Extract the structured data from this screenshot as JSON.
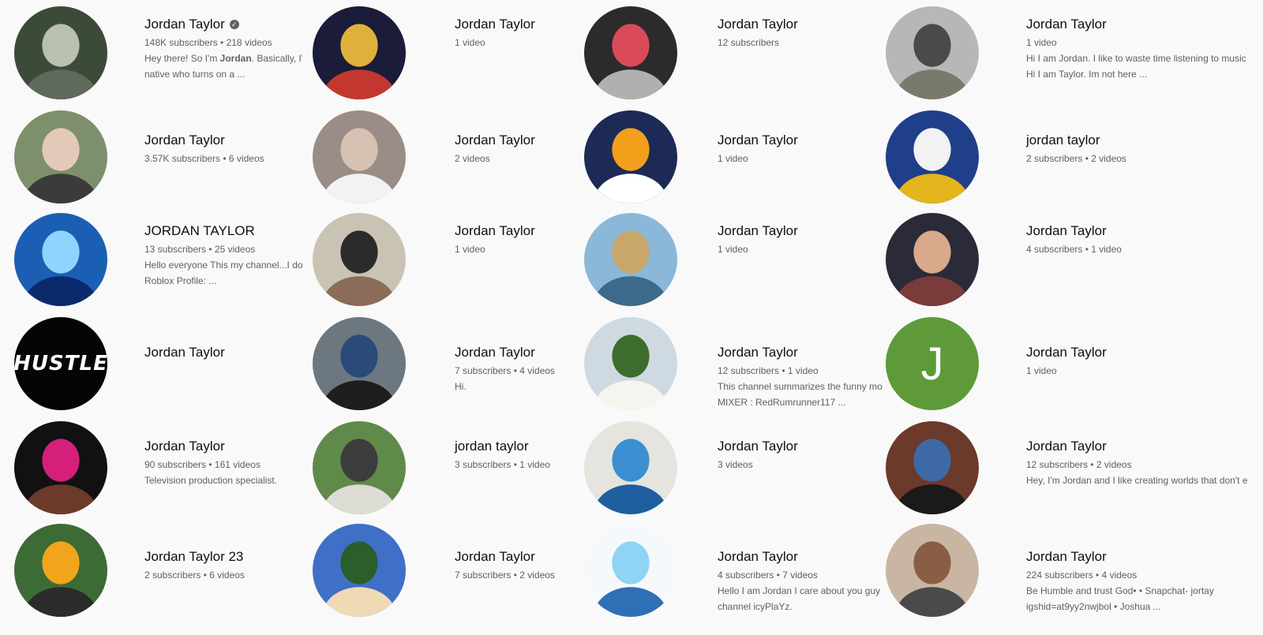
{
  "results": [
    {
      "name": "Jordan Taylor",
      "verified": true,
      "meta": "148K subscribers • 218 videos",
      "desc_lines": [
        "Hey there! So I'm |Jordan|. Basically, I'm",
        "native who turns on a ..."
      ],
      "avatar": {
        "type": "photo",
        "colors": [
          "#3c4a38",
          "#b9c0b0",
          "#5f6a5c"
        ]
      }
    },
    {
      "name": "Jordan Taylor",
      "verified": false,
      "meta": "3.57K subscribers • 6 videos",
      "desc_lines": [],
      "avatar": {
        "type": "photo",
        "colors": [
          "#7e8f6c",
          "#e3c9b8",
          "#3b3b3b"
        ]
      }
    },
    {
      "name": "JORDAN TAYLOR",
      "verified": false,
      "meta": "13 subscribers • 25 videos",
      "desc_lines": [
        "Hello everyone This my channel...I do B",
        "Roblox Profile: ..."
      ],
      "avatar": {
        "type": "photo",
        "colors": [
          "#1b5fb4",
          "#8fd3ff",
          "#0b2a6b"
        ]
      }
    },
    {
      "name": "Jordan Taylor",
      "verified": false,
      "meta": "",
      "desc_lines": [],
      "avatar": {
        "type": "text",
        "text": "HUSTLE",
        "bg": "#050505"
      }
    },
    {
      "name": "Jordan Taylor",
      "verified": false,
      "meta": "90 subscribers • 161 videos",
      "desc_lines": [
        "Television production specialist."
      ],
      "avatar": {
        "type": "photo",
        "colors": [
          "#111111",
          "#d61f7a",
          "#6b3a2a"
        ]
      }
    },
    {
      "name": "Jordan Taylor 23",
      "verified": false,
      "meta": "2 subscribers • 6 videos",
      "desc_lines": [],
      "avatar": {
        "type": "photo",
        "colors": [
          "#3d6b36",
          "#f2a51c",
          "#2b2b2b"
        ]
      }
    },
    {
      "name": "Jordan Taylor",
      "verified": false,
      "meta": "1 video",
      "desc_lines": [],
      "avatar": {
        "type": "photo",
        "colors": [
          "#1b1b3a",
          "#e0b13a",
          "#c4372e"
        ]
      }
    },
    {
      "name": "Jordan Taylor",
      "verified": false,
      "meta": "2 videos",
      "desc_lines": [],
      "avatar": {
        "type": "photo",
        "colors": [
          "#9a8c86",
          "#d7c1b3",
          "#f2f2f2"
        ]
      }
    },
    {
      "name": "Jordan Taylor",
      "verified": false,
      "meta": "1 video",
      "desc_lines": [],
      "avatar": {
        "type": "photo",
        "colors": [
          "#c9c3b4",
          "#2b2b2b",
          "#8a6c58"
        ]
      }
    },
    {
      "name": "Jordan Taylor",
      "verified": false,
      "meta": "7 subscribers • 4 videos",
      "desc_lines": [
        "Hi."
      ],
      "avatar": {
        "type": "photo",
        "colors": [
          "#6d7780",
          "#2a4a7a",
          "#1e1e1e"
        ]
      }
    },
    {
      "name": "jordan taylor",
      "verified": false,
      "meta": "3 subscribers • 1 video",
      "desc_lines": [],
      "avatar": {
        "type": "photo",
        "colors": [
          "#5f8a4a",
          "#3c3c3c",
          "#dcdcd4"
        ]
      }
    },
    {
      "name": "Jordan Taylor",
      "verified": false,
      "meta": "7 subscribers • 2 videos",
      "desc_lines": [],
      "avatar": {
        "type": "photo",
        "colors": [
          "#3f6fc7",
          "#2a5e2a",
          "#f0d9b5"
        ]
      }
    },
    {
      "name": "Jordan Taylor",
      "verified": false,
      "meta": "12 subscribers",
      "desc_lines": [],
      "avatar": {
        "type": "photo",
        "colors": [
          "#2b2b2b",
          "#d94b5a",
          "#b0b0b0"
        ]
      }
    },
    {
      "name": "Jordan Taylor",
      "verified": false,
      "meta": "1 video",
      "desc_lines": [],
      "avatar": {
        "type": "photo",
        "colors": [
          "#1d2a55",
          "#f2a01c",
          "#ffffff"
        ]
      }
    },
    {
      "name": "Jordan Taylor",
      "verified": false,
      "meta": "1 video",
      "desc_lines": [],
      "avatar": {
        "type": "photo",
        "colors": [
          "#8bb7d9",
          "#c9a76a",
          "#3c6a8a"
        ]
      }
    },
    {
      "name": "Jordan Taylor",
      "verified": false,
      "meta": "12 subscribers • 1 video",
      "desc_lines": [
        "This channel summarizes the funny mo",
        "MIXER : RedRumrunner117 ..."
      ],
      "avatar": {
        "type": "photo",
        "colors": [
          "#cfd9e2",
          "#3e6b2e",
          "#f5f5f0"
        ]
      }
    },
    {
      "name": "Jordan Taylor",
      "verified": false,
      "meta": "3 videos",
      "desc_lines": [],
      "avatar": {
        "type": "photo",
        "colors": [
          "#e6e4df",
          "#3b8fd0",
          "#1f5e9e"
        ]
      }
    },
    {
      "name": "Jordan Taylor",
      "verified": false,
      "meta": "4 subscribers • 7 videos",
      "desc_lines": [
        "Hello I am Jordan I care about you guy",
        "channel icyPlaYz."
      ],
      "avatar": {
        "type": "photo",
        "colors": [
          "#f5f9fc",
          "#8fd3f5",
          "#2f6fb6"
        ]
      }
    },
    {
      "name": "Jordan Taylor",
      "verified": false,
      "meta": "1 video",
      "desc_lines": [
        "Hi I am Jordan. I like to waste time listening to music",
        "Hi I am Taylor. Im not here ..."
      ],
      "avatar": {
        "type": "photo",
        "colors": [
          "#b7b7b7",
          "#4a4a4a",
          "#7a7a6c"
        ]
      }
    },
    {
      "name": "jordan taylor",
      "verified": false,
      "meta": "2 subscribers • 2 videos",
      "desc_lines": [],
      "avatar": {
        "type": "photo",
        "colors": [
          "#1f3f8a",
          "#f2f2f2",
          "#e4b51c"
        ]
      }
    },
    {
      "name": "Jordan Taylor",
      "verified": false,
      "meta": "4 subscribers • 1 video",
      "desc_lines": [],
      "avatar": {
        "type": "photo",
        "colors": [
          "#2a2a38",
          "#d8a98a",
          "#7a3b3b"
        ]
      }
    },
    {
      "name": "Jordan Taylor",
      "verified": false,
      "meta": "1 video",
      "desc_lines": [],
      "avatar": {
        "type": "letter",
        "text": "J",
        "bg": "#5e9a3a"
      }
    },
    {
      "name": "Jordan Taylor",
      "verified": false,
      "meta": "12 subscribers • 2 videos",
      "desc_lines": [
        "Hey, I'm Jordan and I like creating worlds that don't exi"
      ],
      "avatar": {
        "type": "photo",
        "colors": [
          "#6b3a2a",
          "#3d6aa6",
          "#1a1a1a"
        ]
      }
    },
    {
      "name": "Jordan Taylor",
      "verified": false,
      "meta": "224 subscribers • 4 videos",
      "desc_lines": [
        "Be Humble and trust God• • Snapchat- jortay",
        "igshid=at9yy2nwjbol • Joshua ..."
      ],
      "avatar": {
        "type": "photo",
        "colors": [
          "#c9b6a2",
          "#8a5e44",
          "#4a4a4a"
        ]
      }
    }
  ]
}
